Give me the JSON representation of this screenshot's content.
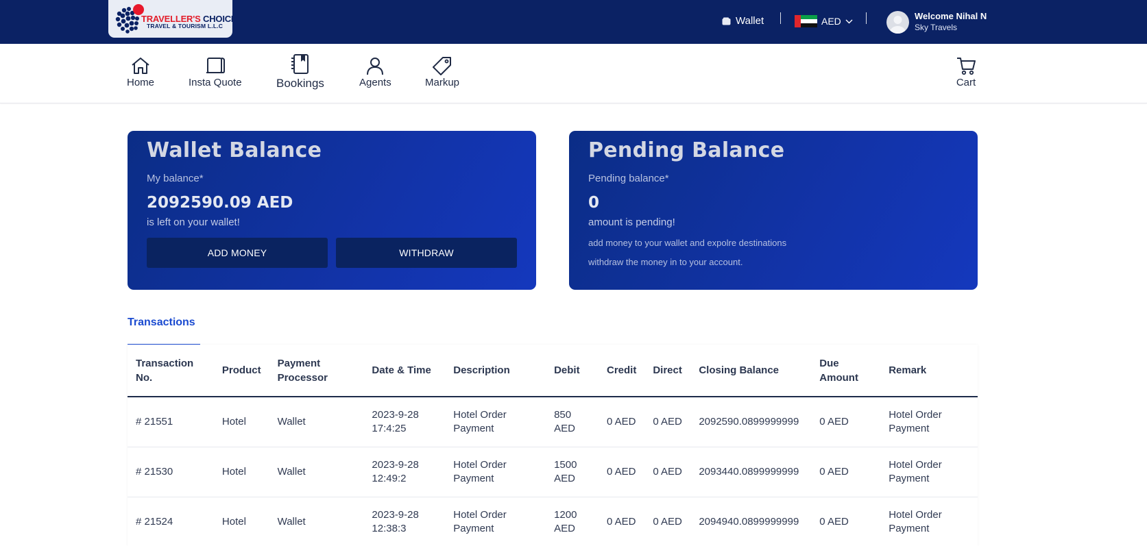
{
  "brand": {
    "line1_red": "TRAVELLER'S",
    "line1_navy": "CHOICE",
    "line2": "TRAVEL & TOURISM L.L.C",
    "colors": {
      "navy": "#0b2264",
      "red": "#e21d2a"
    }
  },
  "header": {
    "wallet_label": "Wallet",
    "currency": "AED",
    "user_greeting": "Welcome Nihal N",
    "user_company": "Sky Travels"
  },
  "nav": {
    "items": [
      {
        "label": "Home",
        "icon": "home-icon"
      },
      {
        "label": "Insta Quote",
        "icon": "quote-icon"
      },
      {
        "label": "Bookings",
        "icon": "bookings-icon"
      },
      {
        "label": "Agents",
        "icon": "user-icon"
      },
      {
        "label": "Markup",
        "icon": "tag-icon"
      }
    ],
    "cart_label": "Cart"
  },
  "wallet_card": {
    "title": "Wallet Balance",
    "subtitle": "My balance*",
    "amount": "2092590.09 AED",
    "note": "is left on your wallet!",
    "add_money_label": "ADD MONEY",
    "withdraw_label": "WITHDRAW"
  },
  "pending_card": {
    "title": "Pending Balance",
    "subtitle": "Pending balance*",
    "amount": "0",
    "note": "amount is pending!",
    "info1": "add money to your wallet and expolre destinations",
    "info2": "withdraw the money in to your account."
  },
  "transactions": {
    "tab_label": "Transactions",
    "columns": [
      "Transaction No.",
      "Product",
      "Payment Processor",
      "Date & Time",
      "Description",
      "Debit",
      "Credit",
      "Direct",
      "Closing Balance",
      "Due Amount",
      "Remark"
    ],
    "rows": [
      {
        "no": "# 21551",
        "product": "Hotel",
        "processor": "Wallet",
        "date": "2023-9-28",
        "time": "17:4:25",
        "description": "Hotel Order Payment",
        "debit_value": "850",
        "debit_unit": "AED",
        "credit": "0 AED",
        "direct": "0 AED",
        "closing": "2092590.0899999999",
        "due": "0 AED",
        "remark": "Hotel Order Payment"
      },
      {
        "no": "# 21530",
        "product": "Hotel",
        "processor": "Wallet",
        "date": "2023-9-28",
        "time": "12:49:2",
        "description": "Hotel Order Payment",
        "debit_value": "1500",
        "debit_unit": "AED",
        "credit": "0 AED",
        "direct": "0 AED",
        "closing": "2093440.0899999999",
        "due": "0 AED",
        "remark": "Hotel Order Payment"
      },
      {
        "no": "# 21524",
        "product": "Hotel",
        "processor": "Wallet",
        "date": "2023-9-28",
        "time": "12:38:3",
        "description": "Hotel Order Payment",
        "debit_value": "1200",
        "debit_unit": "AED",
        "credit": "0 AED",
        "direct": "0 AED",
        "closing": "2094940.0899999999",
        "due": "0 AED",
        "remark": "Hotel Order Payment"
      }
    ]
  }
}
